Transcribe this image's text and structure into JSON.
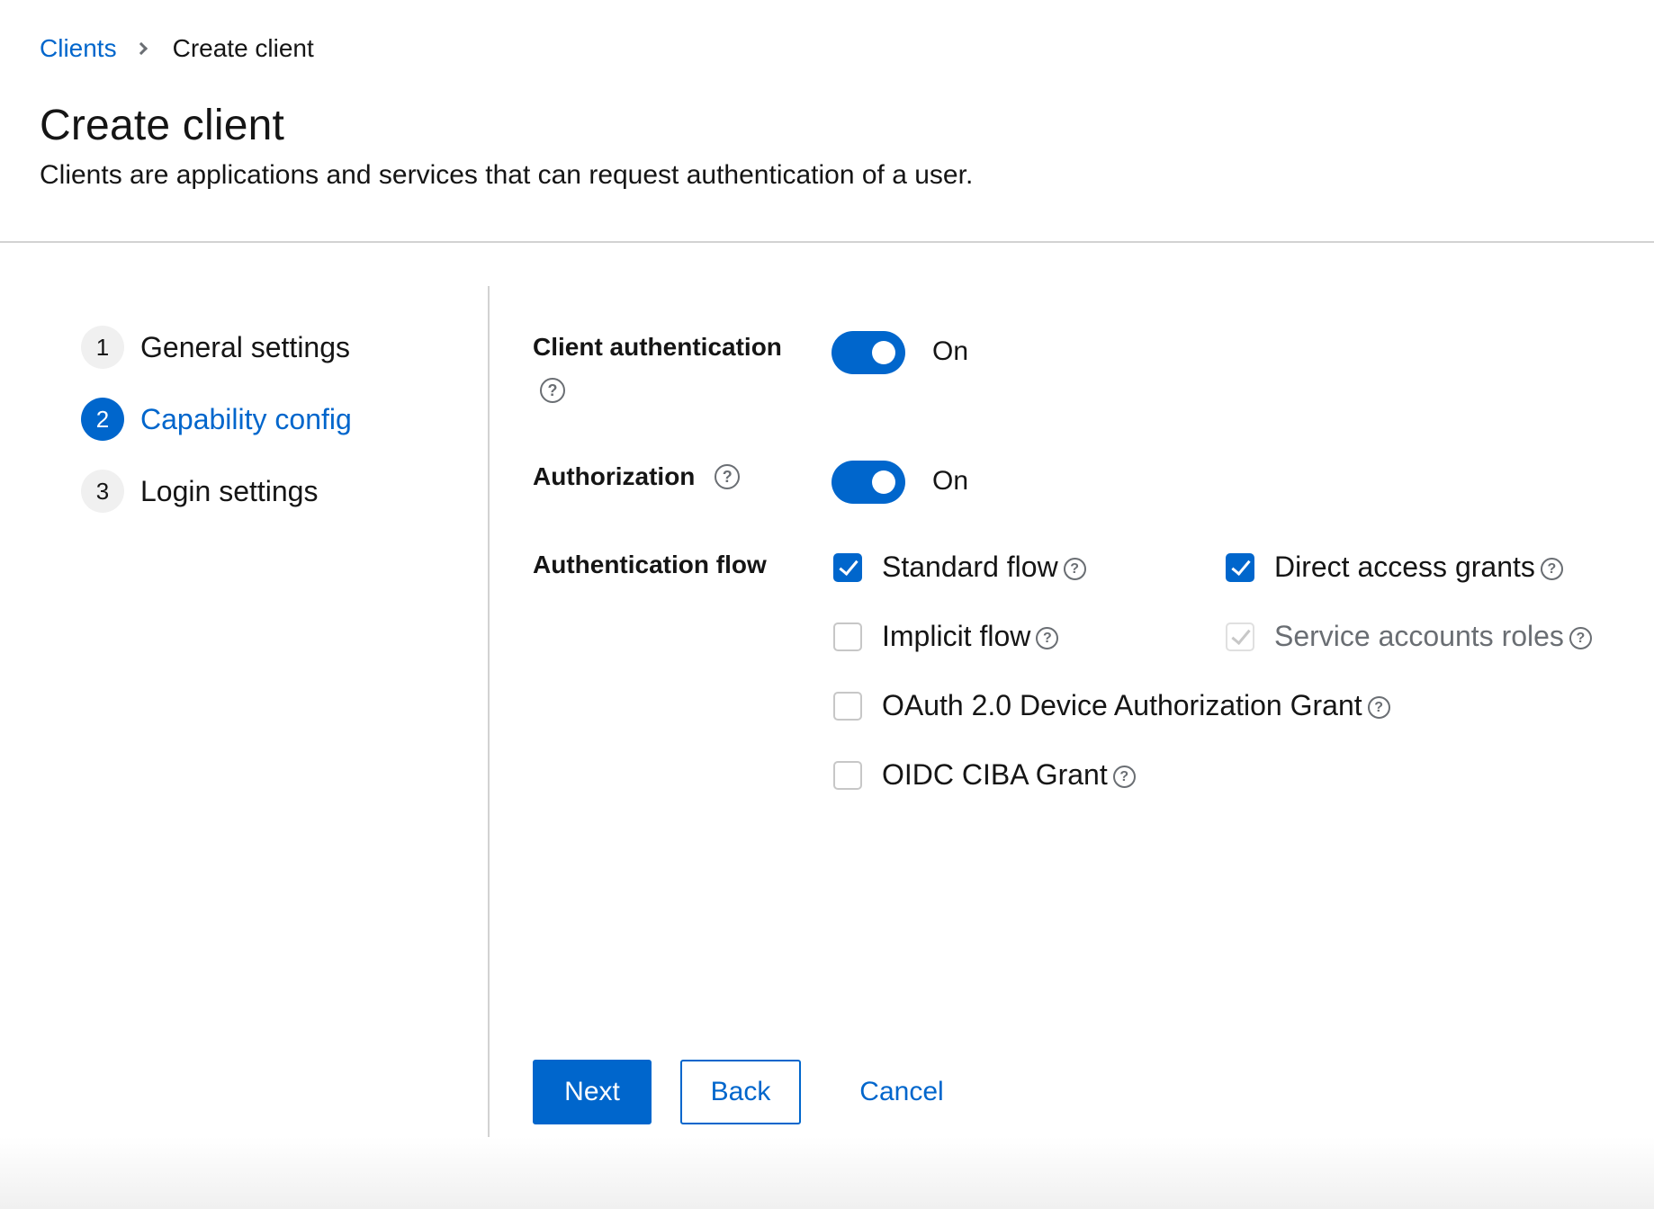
{
  "breadcrumb": {
    "parent": "Clients",
    "current": "Create client"
  },
  "header": {
    "title": "Create client",
    "description": "Clients are applications and services that can request authentication of a user."
  },
  "wizard": {
    "steps": [
      {
        "number": "1",
        "label": "General settings",
        "active": false
      },
      {
        "number": "2",
        "label": "Capability config",
        "active": true
      },
      {
        "number": "3",
        "label": "Login settings",
        "active": false
      }
    ]
  },
  "form": {
    "client_authentication": {
      "label": "Client authentication",
      "state": "On",
      "enabled": true
    },
    "authorization": {
      "label": "Authorization",
      "state": "On",
      "enabled": true
    },
    "authentication_flow": {
      "label": "Authentication flow",
      "options": [
        {
          "label": "Standard flow",
          "checked": true,
          "disabled": false
        },
        {
          "label": "Direct access grants",
          "checked": true,
          "disabled": false
        },
        {
          "label": "Implicit flow",
          "checked": false,
          "disabled": false
        },
        {
          "label": "Service accounts roles",
          "checked": true,
          "disabled": true
        },
        {
          "label": "OAuth 2.0 Device Authorization Grant",
          "checked": false,
          "disabled": false
        },
        {
          "label": "OIDC CIBA Grant",
          "checked": false,
          "disabled": false
        }
      ]
    }
  },
  "actions": {
    "next": "Next",
    "back": "Back",
    "cancel": "Cancel"
  },
  "icons": {
    "help": "help-circle-icon",
    "help_glyph": "?",
    "breadcrumb_separator": "chevron-right-icon"
  },
  "colors": {
    "accent": "#0066cc",
    "text": "#151515",
    "muted": "#6a6e73",
    "divider": "#d2d2d2"
  }
}
